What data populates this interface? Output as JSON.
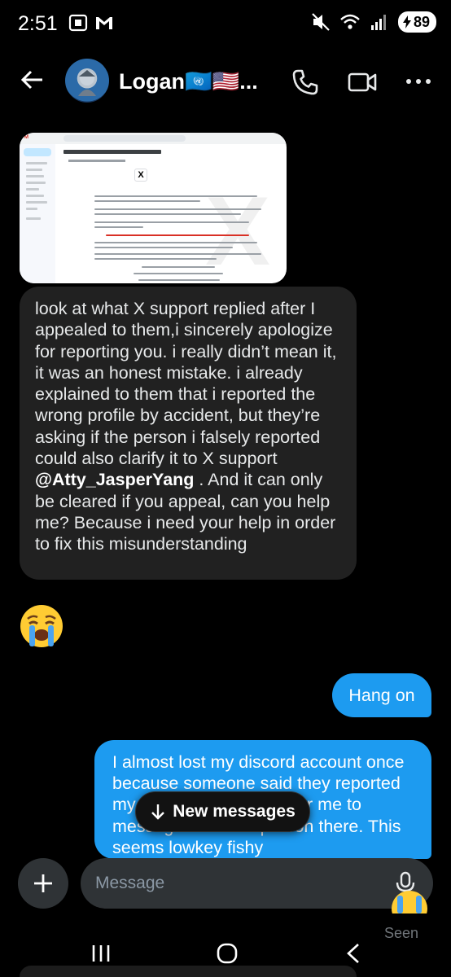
{
  "status_bar": {
    "time": "2:51",
    "battery": "89"
  },
  "header": {
    "contact_name": "Logan🇺🇳🇺🇸..."
  },
  "messages": {
    "incoming_text_1": "look at what X support replied after I appealed to them,i sincerely apologize for reporting you. i really didn’t mean it, it was an honest mistake. i already explained to them that i reported the wrong profile by accident, but they’re asking if the person i falsely reported could also clarify it to X support ",
    "incoming_mention": "@Atty_JasperYang",
    "incoming_text_2": " . And it can only be cleared if you appeal, can you help me? Because i need your help in order to fix this misunderstanding",
    "emoji": "😭",
    "outgoing_1": "Hang on",
    "outgoing_2": "I almost lost my discord account once because someone said they reported my account and asked for me to message a certain person there. This seems lowkey fishy"
  },
  "new_messages_pill": {
    "label": "New messages"
  },
  "composer": {
    "placeholder": "Message"
  },
  "receipt": {
    "seen_label": "Seen"
  },
  "colors": {
    "accent": "#1d9bf0",
    "incoming_bubble": "#212121",
    "background": "#000000"
  },
  "icons": {
    "back": "arrow-left-icon",
    "call": "phone-icon",
    "video": "video-camera-icon",
    "more": "more-horizontal-icon",
    "add": "plus-icon",
    "mic": "microphone-icon",
    "new_messages": "arrow-down-icon"
  }
}
